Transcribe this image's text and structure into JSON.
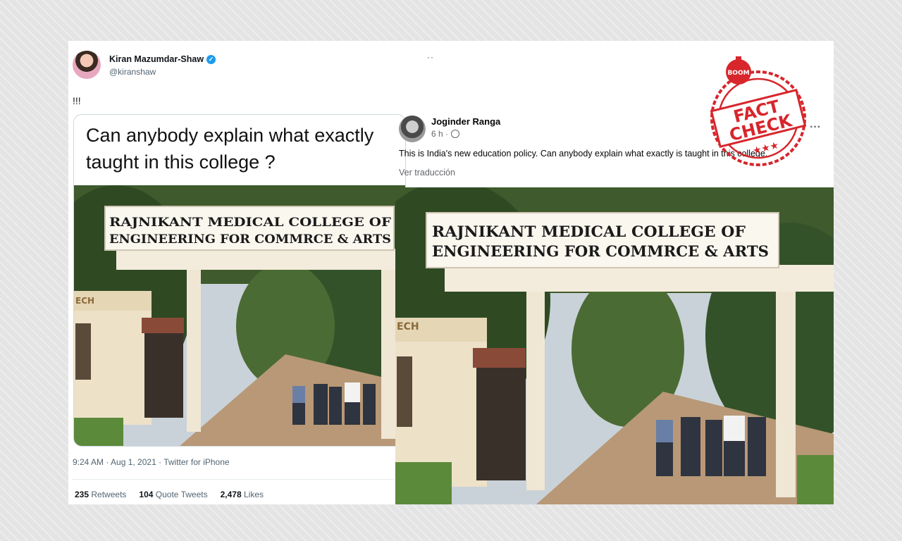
{
  "tweet": {
    "name": "Kiran Mazumdar-Shaw",
    "handle": "@kiranshaw",
    "text": "!!!",
    "caption_line1": "Can anybody explain what exactly",
    "caption_line2": "taught in this college ?",
    "meta": "9:24 AM · Aug 1, 2021 · Twitter for iPhone",
    "stats": [
      {
        "value": "235",
        "label": "Retweets"
      },
      {
        "value": "104",
        "label": "Quote Tweets"
      },
      {
        "value": "2,478",
        "label": "Likes"
      }
    ]
  },
  "separator_dots": "··",
  "facebook": {
    "name": "Joginder Ranga",
    "time": "6 h ·",
    "more": "···",
    "text": "This is India's new education policy. Can anybody explain what exactly is taught in this college.",
    "translate": "Ver traducción"
  },
  "photo": {
    "sign_line1": "RAJNIKANT MEDICAL COLLEGE OF",
    "sign_line2": "ENGINEERING FOR COMMRCE & ARTS",
    "booth_label": "ECH"
  },
  "stamp": {
    "brand": "BOOM",
    "word1": "FACT",
    "word2": "CHECK",
    "stars": "★★★",
    "color": "#d7262c"
  }
}
